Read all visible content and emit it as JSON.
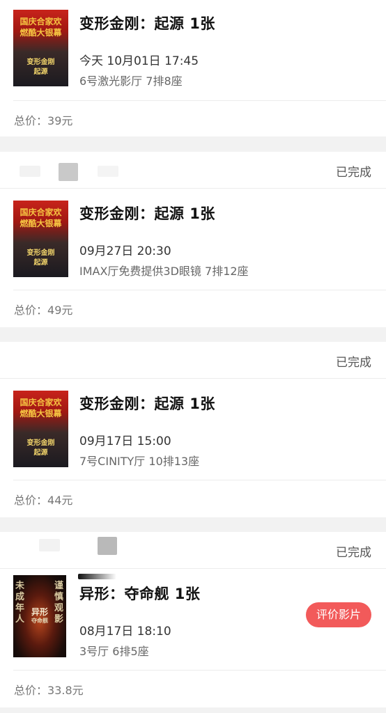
{
  "orders": [
    {
      "status": "",
      "poster": "transformers-poster",
      "title": "变形金刚：起源 1张",
      "datetime": "今天 10月01日 17:45",
      "hall_seat": "6号激光影厅 7排8座",
      "total_label": "总价：",
      "total_value": "39元"
    },
    {
      "status": "已完成",
      "poster": "transformers-poster",
      "title": "变形金刚：起源 1张",
      "datetime": "09月27日 20:30",
      "hall_seat": "IMAX厅免费提供3D眼镜 7排12座",
      "total_label": "总价：",
      "total_value": "49元"
    },
    {
      "status": "已完成",
      "poster": "transformers-poster",
      "title": "变形金刚：起源 1张",
      "datetime": "09月17日 15:00",
      "hall_seat": "7号CINITY厅 10排13座",
      "total_label": "总价：",
      "total_value": "44元"
    },
    {
      "status": "已完成",
      "poster": "alien-poster",
      "title": "异形：夺命舰 1张",
      "datetime": "08月17日 18:10",
      "hall_seat": "3号厅 6排5座",
      "total_label": "总价：",
      "total_value": "33.8元",
      "action_label": "评价影片"
    }
  ],
  "posters": {
    "transformers": {
      "top_line1": "国庆合家欢",
      "top_line2": "燃酷大银幕",
      "mid_line1": "变形金刚",
      "mid_line2": "起源"
    },
    "alien": {
      "left_text": "未成年人",
      "right_text": "谨慎观影",
      "center_line1": "异形",
      "center_line2": "夺命舰"
    }
  },
  "colors": {
    "accent": "#f25a5a",
    "poster_red": "#c8231b",
    "poster_gold": "#f5c542",
    "background": "#f2f2f2"
  }
}
